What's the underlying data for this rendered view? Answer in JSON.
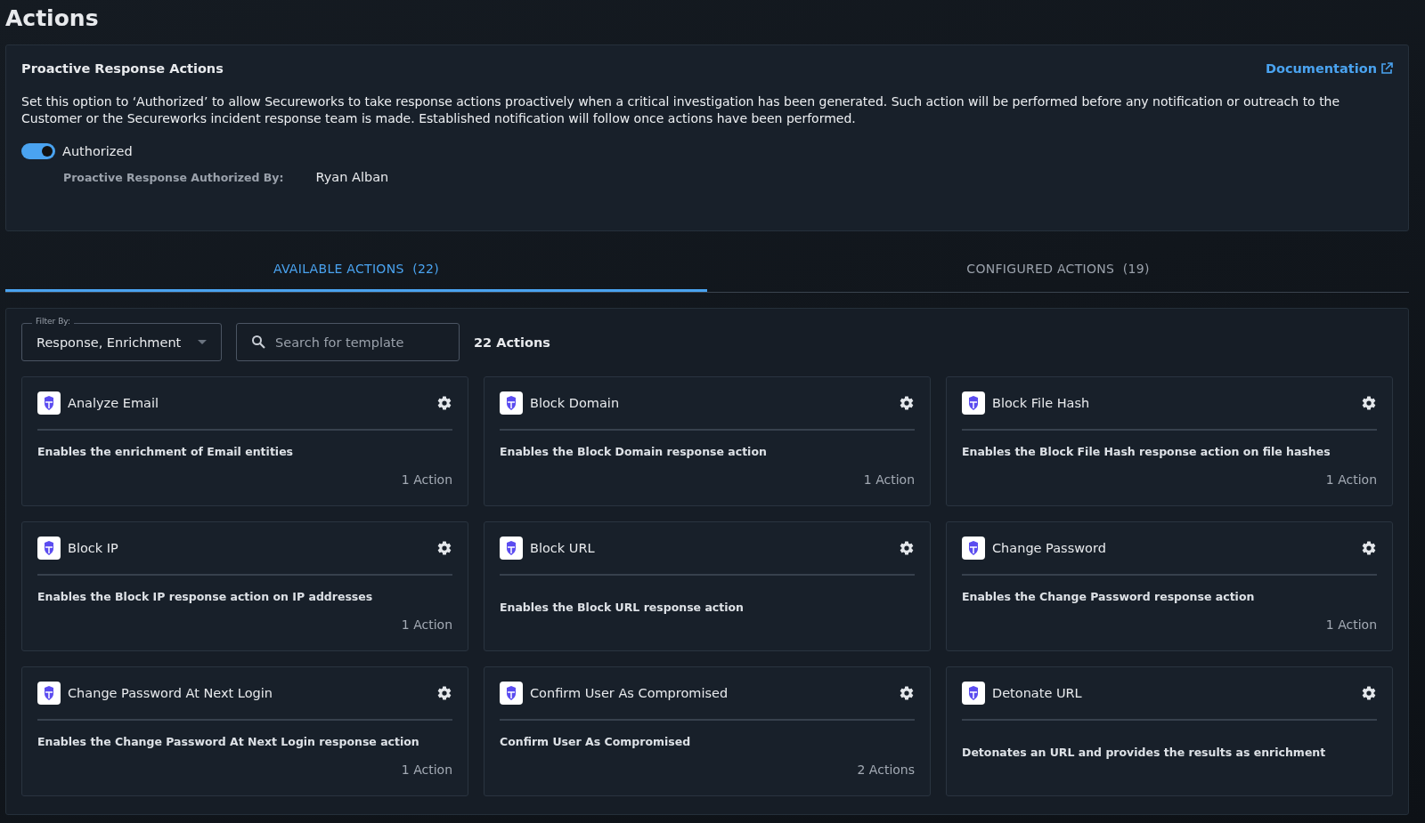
{
  "page_title": "Actions",
  "proactive": {
    "title": "Proactive Response Actions",
    "doc_link": "Documentation",
    "description": "Set this option to ‘Authorized’ to allow Secureworks to take response actions proactively when a critical investigation has been generated. Such action will be performed before any notification or outreach to the Customer or the Secureworks incident response team is made. Established notification will follow once actions have been performed.",
    "toggle": {
      "label": "Authorized",
      "on": true
    },
    "authorized_by_label": "Proactive Response Authorized By:",
    "authorized_by": "Ryan Alban"
  },
  "tabs": [
    {
      "label": "AVAILABLE ACTIONS",
      "count": "(22)",
      "selected": true
    },
    {
      "label": "CONFIGURED ACTIONS",
      "count": "(19)",
      "selected": false
    }
  ],
  "filter": {
    "label": "Filter By:",
    "value": "Response, Enrichment"
  },
  "search": {
    "placeholder": "Search for template"
  },
  "total": "22 Actions",
  "cards": [
    {
      "title": "Analyze Email",
      "description": "Enables the enrichment of Email entities",
      "count": "1 Action"
    },
    {
      "title": "Block Domain",
      "description": "Enables the Block Domain response action",
      "count": "1 Action"
    },
    {
      "title": "Block File Hash",
      "description": "Enables the Block File Hash response action on file hashes",
      "count": "1 Action"
    },
    {
      "title": "Block IP",
      "description": "Enables the Block IP response action on IP addresses",
      "count": "1 Action"
    },
    {
      "title": "Block URL",
      "description": "Enables the Block URL response action"
    },
    {
      "title": "Change Password",
      "description": "Enables the Change Password response action",
      "count": "1 Action"
    },
    {
      "title": "Change Password At Next Login",
      "description": "Enables the Change Password At Next Login response action",
      "count": "1 Action"
    },
    {
      "title": "Confirm User As Compromised",
      "description": "Confirm User As Compromised",
      "count": "2 Actions"
    },
    {
      "title": "Detonate URL",
      "description": "Detonates an URL and provides the results as enrichment"
    }
  ]
}
